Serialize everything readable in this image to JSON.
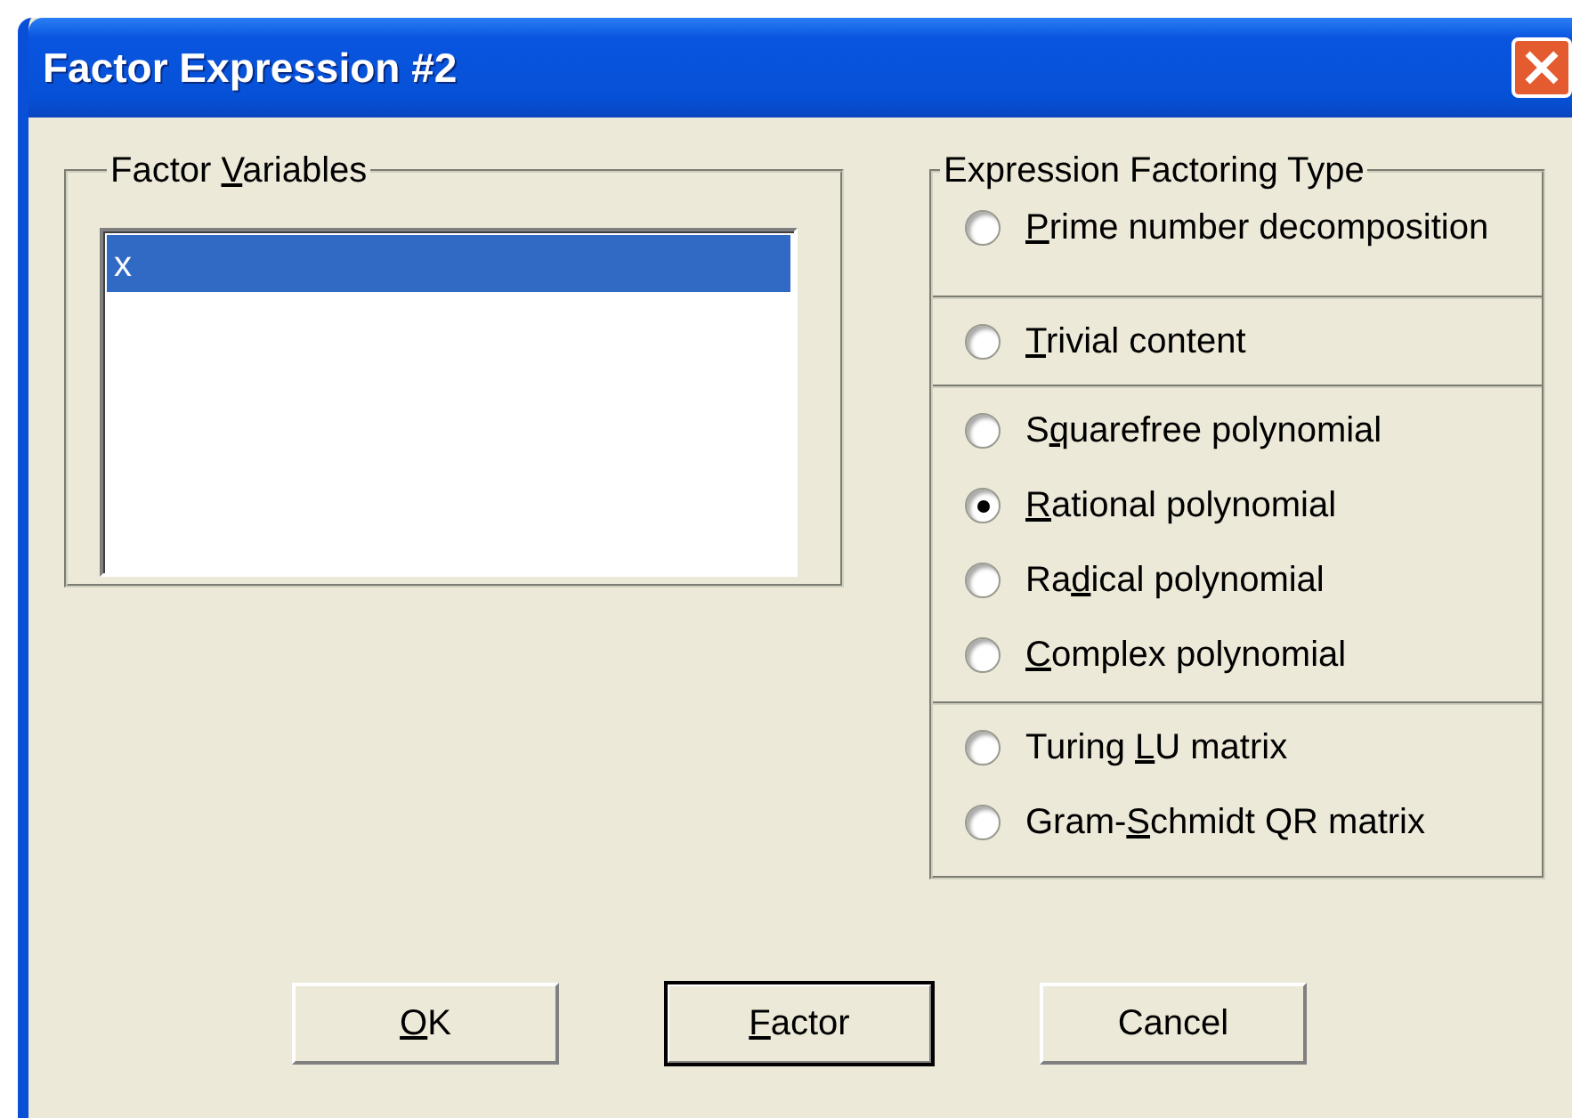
{
  "window": {
    "title": "Factor Expression #2"
  },
  "factor_variables": {
    "title": {
      "before": "Factor ",
      "key": "V",
      "after": "ariables"
    },
    "items": [
      {
        "label": "x",
        "selected": true
      }
    ]
  },
  "factoring_type": {
    "title": {
      "before": "Expression Factoring Type"
    },
    "sections": [
      {
        "options": [
          {
            "label": {
              "key": "P",
              "after": "rime number decomposition"
            },
            "selected": false
          }
        ]
      },
      {
        "options": [
          {
            "label": {
              "key": "T",
              "after": "rivial content"
            },
            "selected": false
          }
        ]
      },
      {
        "options": [
          {
            "label": {
              "before": "S",
              "key": "q",
              "after": "uarefree polynomial"
            },
            "selected": false
          },
          {
            "label": {
              "key": "R",
              "after": "ational polynomial"
            },
            "selected": true
          },
          {
            "label": {
              "before": "Ra",
              "key": "d",
              "after": "ical polynomial"
            },
            "selected": false
          },
          {
            "label": {
              "key": "C",
              "after": "omplex polynomial"
            },
            "selected": false
          }
        ]
      },
      {
        "options": [
          {
            "label": {
              "before": "Turing ",
              "key": "L",
              "after": "U matrix"
            },
            "selected": false
          },
          {
            "label": {
              "before": "Gram-",
              "key": "S",
              "after": "chmidt QR matrix"
            },
            "selected": false
          }
        ]
      }
    ]
  },
  "buttons": [
    {
      "label": {
        "key": "O",
        "after": "K"
      },
      "default": false
    },
    {
      "label": {
        "key": "F",
        "after": "actor"
      },
      "default": true
    },
    {
      "label": {
        "before": "Cancel"
      },
      "default": false
    }
  ]
}
